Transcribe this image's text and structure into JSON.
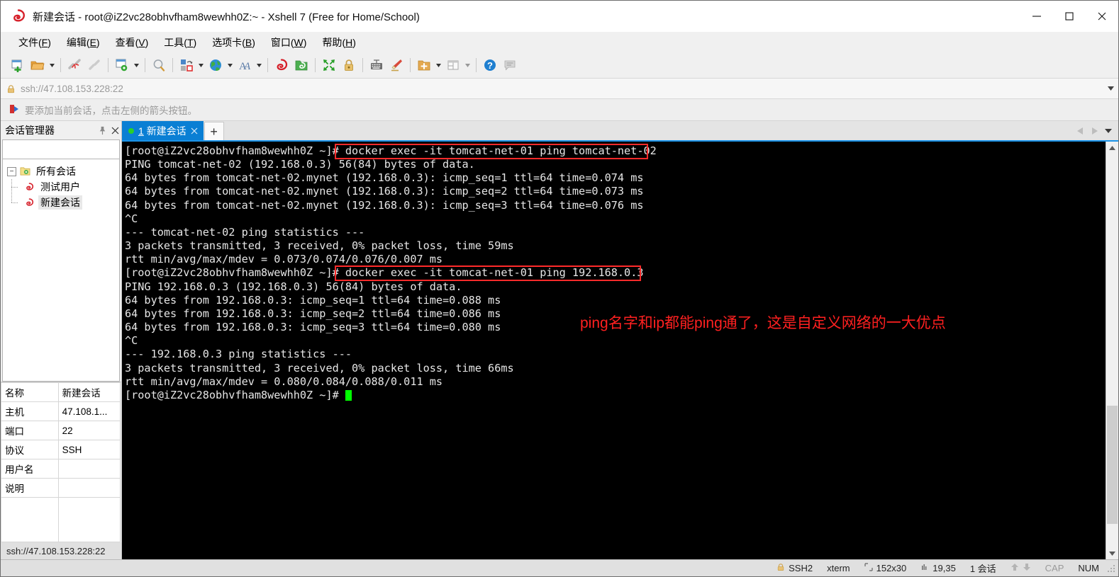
{
  "window": {
    "title": "新建会话 - root@iZ2vc28obhvfham8wewhh0Z:~ - Xshell 7 (Free for Home/School)",
    "minimize_label": "最小化",
    "maximize_label": "最大化",
    "close_label": "关闭"
  },
  "menubar": [
    {
      "label": "文件",
      "mnemonic": "F"
    },
    {
      "label": "编辑",
      "mnemonic": "E"
    },
    {
      "label": "查看",
      "mnemonic": "V"
    },
    {
      "label": "工具",
      "mnemonic": "T"
    },
    {
      "label": "选项卡",
      "mnemonic": "B"
    },
    {
      "label": "窗口",
      "mnemonic": "W"
    },
    {
      "label": "帮助",
      "mnemonic": "H"
    }
  ],
  "toolbar": {
    "items": [
      {
        "name": "new-session-icon",
        "has_arrow": false
      },
      {
        "name": "open-folder-icon",
        "has_arrow": true
      },
      {
        "name": "disconnect-icon",
        "has_arrow": false
      },
      {
        "name": "reconnect-icon",
        "has_arrow": false
      },
      {
        "name": "session-properties-icon",
        "has_arrow": true
      },
      {
        "name": "find-icon",
        "has_arrow": false
      },
      {
        "name": "transfer-file-icon",
        "has_arrow": true
      },
      {
        "name": "globe-icon",
        "has_arrow": true
      },
      {
        "name": "font-icon",
        "has_arrow": true
      },
      {
        "name": "xshell-icon",
        "has_arrow": false
      },
      {
        "name": "xftp-icon",
        "has_arrow": false
      },
      {
        "name": "fullscreen-icon",
        "has_arrow": false
      },
      {
        "name": "lock-icon",
        "has_arrow": false
      },
      {
        "name": "keyboard-icon",
        "has_arrow": false
      },
      {
        "name": "highlight-icon",
        "has_arrow": false
      },
      {
        "name": "add-folder-icon",
        "has_arrow": true
      },
      {
        "name": "layout-icon",
        "has_arrow": true
      },
      {
        "name": "help-icon",
        "has_arrow": false
      },
      {
        "name": "comment-icon",
        "has_arrow": false
      }
    ]
  },
  "address_bar": {
    "value": "ssh://47.108.153.228:22",
    "lock_icon": "lock-icon",
    "dropdown_icon": "chevron-down-icon"
  },
  "notice_bar": {
    "text": "要添加当前会话，点击左侧的箭头按钮。",
    "icon": "arrow-flag-icon"
  },
  "sidebar": {
    "title": "会话管理器",
    "pin_icon": "pin-icon",
    "close_icon": "close-icon",
    "search": {
      "value": "",
      "placeholder": "",
      "icon": "search-icon"
    },
    "tree": {
      "root": {
        "label": "所有会话",
        "icon": "folder-sessions-icon",
        "expanded": true
      },
      "children": [
        {
          "label": "测试用户",
          "icon": "session-icon",
          "selected": false
        },
        {
          "label": "新建会话",
          "icon": "session-icon",
          "selected": true
        }
      ]
    },
    "properties": [
      {
        "key": "名称",
        "value": "新建会话"
      },
      {
        "key": "主机",
        "value": "47.108.1..."
      },
      {
        "key": "端口",
        "value": "22"
      },
      {
        "key": "协议",
        "value": "SSH"
      },
      {
        "key": "用户名",
        "value": ""
      },
      {
        "key": "说明",
        "value": ""
      },
      {
        "key": "",
        "value": ""
      }
    ],
    "status_text": "ssh://47.108.153.228:22"
  },
  "tabs": {
    "items": [
      {
        "index": "1",
        "label": "新建会话",
        "active": true,
        "status_dot_color": "#2ad02a",
        "close_icon": "close-icon"
      }
    ],
    "new_tab_label": "+",
    "scroll_left_icon": "triangle-left-icon",
    "scroll_right_icon": "triangle-right-icon",
    "tab_list_icon": "chevron-down-icon"
  },
  "terminal": {
    "lines": [
      "[root@iZ2vc28obhvfham8wewhh0Z ~]# docker exec -it tomcat-net-01 ping tomcat-net-02",
      "PING tomcat-net-02 (192.168.0.3) 56(84) bytes of data.",
      "64 bytes from tomcat-net-02.mynet (192.168.0.3): icmp_seq=1 ttl=64 time=0.074 ms",
      "64 bytes from tomcat-net-02.mynet (192.168.0.3): icmp_seq=2 ttl=64 time=0.073 ms",
      "64 bytes from tomcat-net-02.mynet (192.168.0.3): icmp_seq=3 ttl=64 time=0.076 ms",
      "^C",
      "--- tomcat-net-02 ping statistics ---",
      "3 packets transmitted, 3 received, 0% packet loss, time 59ms",
      "rtt min/avg/max/mdev = 0.073/0.074/0.076/0.007 ms",
      "[root@iZ2vc28obhvfham8wewhh0Z ~]# docker exec -it tomcat-net-01 ping 192.168.0.3",
      "PING 192.168.0.3 (192.168.0.3) 56(84) bytes of data.",
      "64 bytes from 192.168.0.3: icmp_seq=1 ttl=64 time=0.088 ms",
      "64 bytes from 192.168.0.3: icmp_seq=2 ttl=64 time=0.086 ms",
      "64 bytes from 192.168.0.3: icmp_seq=3 ttl=64 time=0.080 ms",
      "^C",
      "--- 192.168.0.3 ping statistics ---",
      "3 packets transmitted, 3 received, 0% packet loss, time 66ms",
      "rtt min/avg/max/mdev = 0.080/0.084/0.088/0.011 ms"
    ],
    "prompt": "[root@iZ2vc28obhvfham8wewhh0Z ~]# ",
    "annotation": "ping名字和ip都能ping通了，这是自定义网络的一大优点",
    "annotation_color": "#ff2020",
    "highlight_color": "#ff2a2a"
  },
  "statusbar": {
    "connection": "SSH2",
    "terminal_type": "xterm",
    "size": "152x30",
    "cursor": "19,35",
    "sessions": "1 会话",
    "cap": "CAP",
    "num": "NUM",
    "lock_icon": "lock-icon",
    "size_icon": "resize-icon",
    "cursor_icon": "cursor-icon",
    "up_icon": "arrow-up-icon",
    "down_icon": "arrow-down-icon"
  }
}
